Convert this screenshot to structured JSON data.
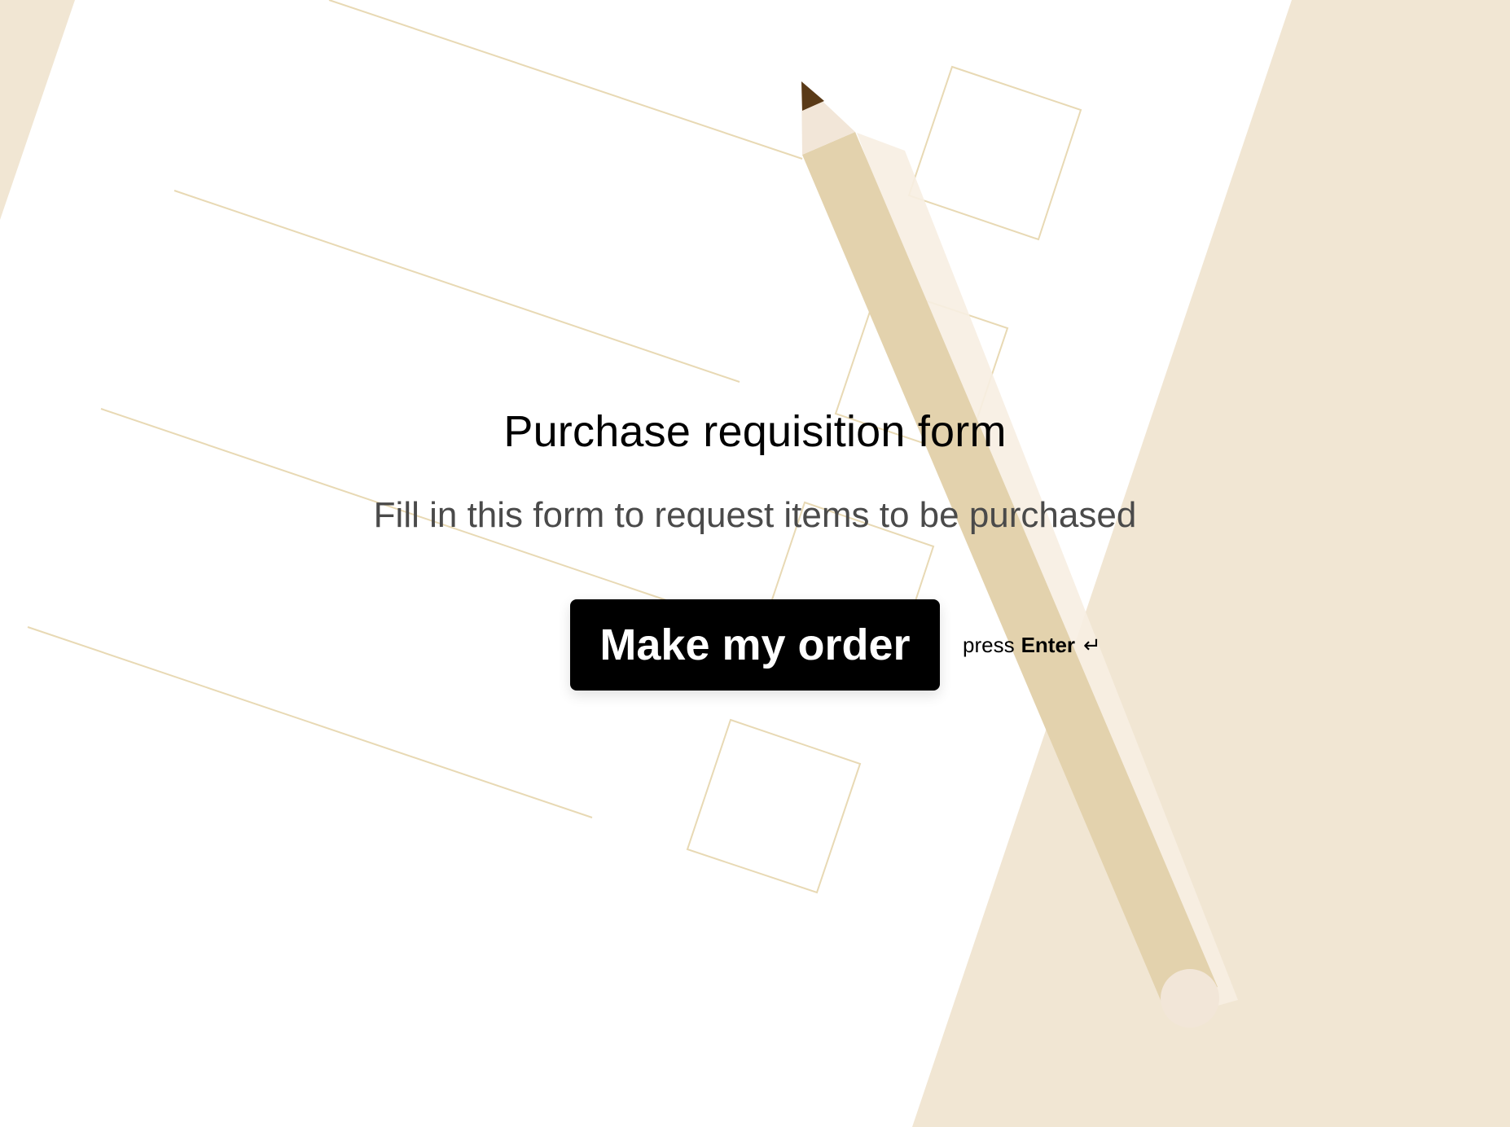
{
  "page": {
    "title": "Purchase requisition form",
    "subtitle": "Fill in this form to request items to be purchased"
  },
  "cta": {
    "button_label": "Make my order",
    "hint_prefix": "press",
    "hint_key": "Enter",
    "hint_icon": "↵"
  },
  "colors": {
    "background": "#f1e6d3",
    "paper": "#ffffff",
    "line": "#e8d9b4",
    "pencil_body": "#e3d2ad",
    "pencil_wood": "#f2e6d8",
    "pencil_lead": "#5a3a17",
    "button": "#000000",
    "button_text": "#ffffff"
  },
  "icons": {
    "enter": "return-arrow-icon",
    "pencil": "pencil-illustration",
    "checkbox": "checkbox-outline"
  }
}
